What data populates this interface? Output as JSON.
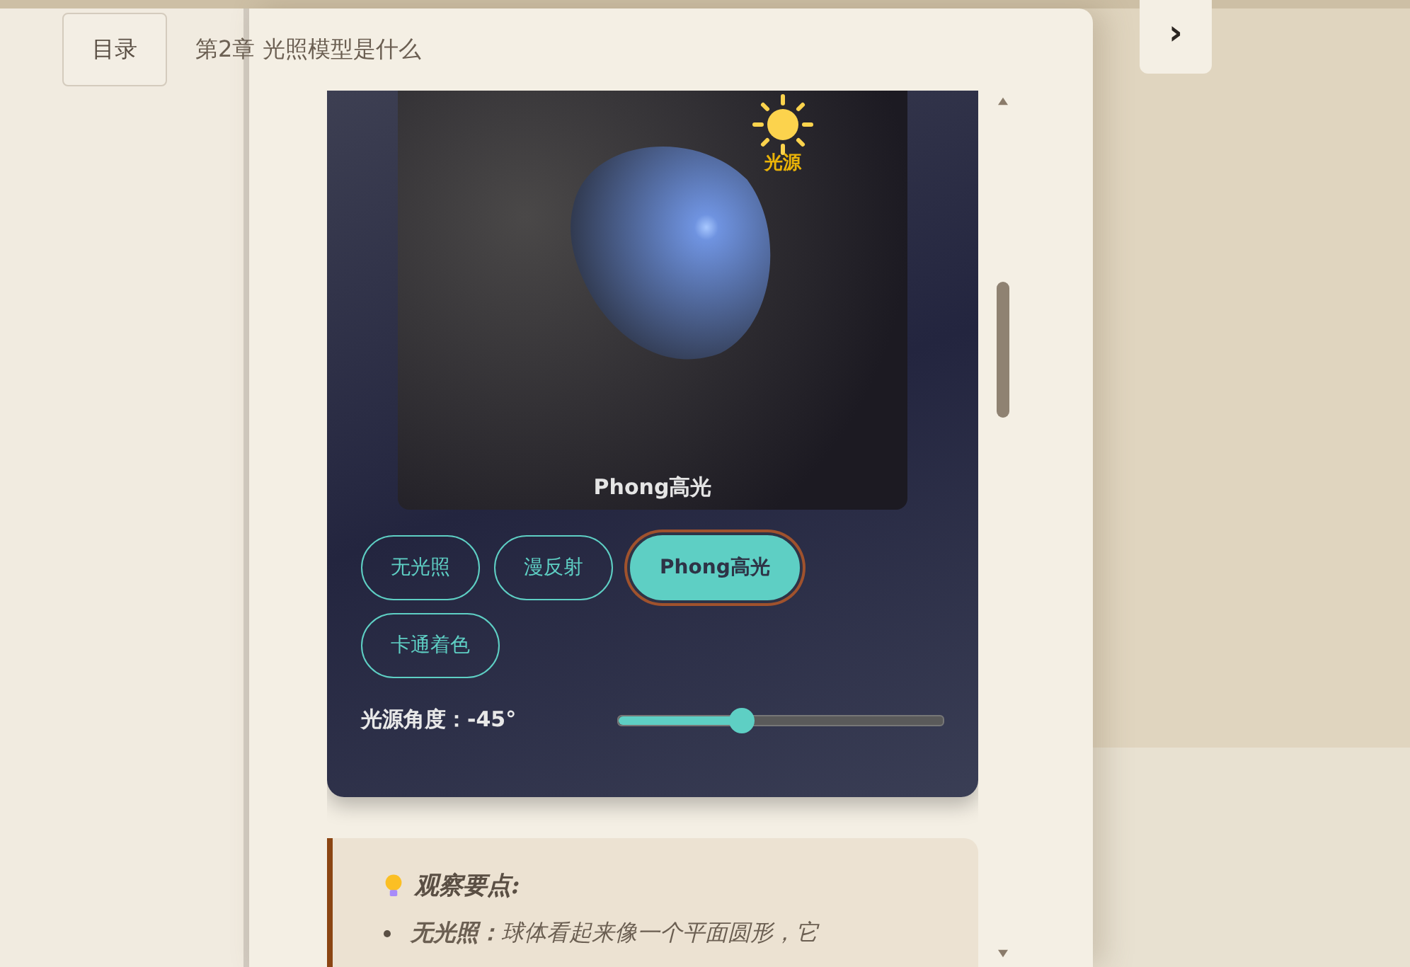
{
  "header": {
    "toc_button": "目录",
    "chapter_title": "第2章 光照模型是什么"
  },
  "next_button": "›",
  "demo": {
    "light_label": "光源",
    "canvas_caption": "Phong高光",
    "modes": [
      {
        "label": "无光照",
        "selected": false
      },
      {
        "label": "漫反射",
        "selected": false
      },
      {
        "label": "Phong高光",
        "selected": true
      },
      {
        "label": "卡通着色",
        "selected": false
      }
    ],
    "slider": {
      "label": "光源角度：-45°",
      "level": 0.38
    }
  },
  "note": {
    "title": "观察要点:",
    "items": [
      {
        "text": "**无光照：**球体看起来像一个平面圆形，它"
      }
    ]
  }
}
